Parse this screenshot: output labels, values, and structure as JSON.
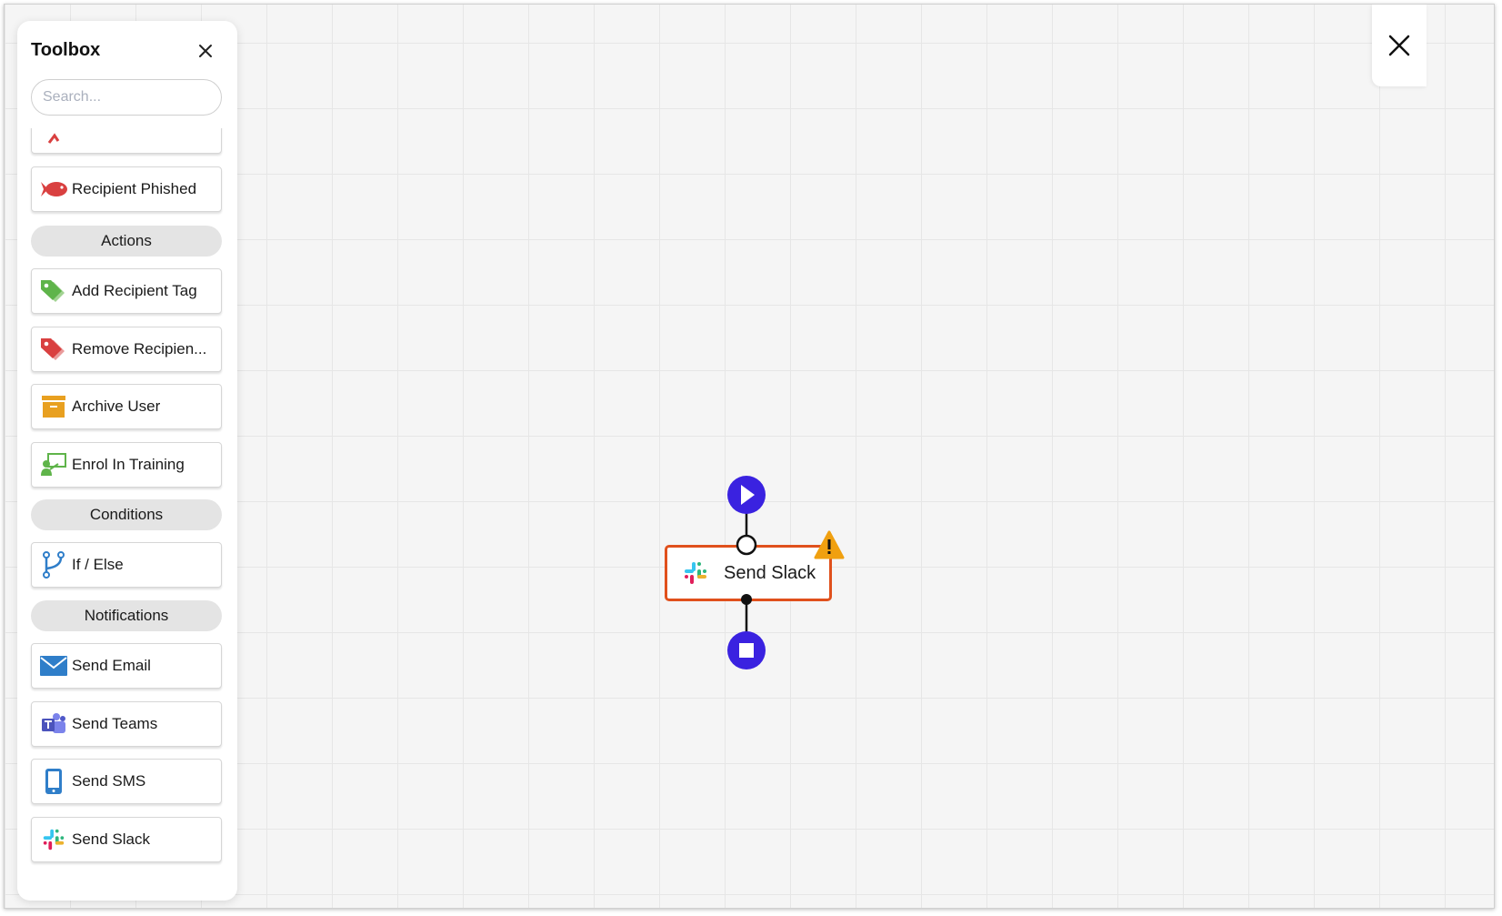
{
  "toolbox": {
    "title": "Toolbox",
    "search_placeholder": "Search...",
    "items": {
      "recipient_phished": "Recipient Phished",
      "add_recipient_tag": "Add Recipient Tag",
      "remove_recipient_tag": "Remove Recipien...",
      "archive_user": "Archive User",
      "enrol_in_training": "Enrol In Training",
      "if_else": "If / Else",
      "send_email": "Send Email",
      "send_teams": "Send Teams",
      "send_sms": "Send SMS",
      "send_slack": "Send Slack"
    },
    "sections": {
      "actions": "Actions",
      "conditions": "Conditions",
      "notifications": "Notifications"
    }
  },
  "canvas": {
    "node_label": "Send Slack",
    "node_icon": "slack-icon",
    "node_status": "warning"
  },
  "colors": {
    "start_end": "#3a22e0",
    "node_border": "#e0501c",
    "warning": "#f0a010"
  }
}
